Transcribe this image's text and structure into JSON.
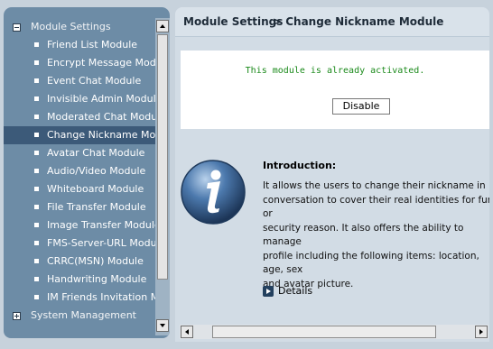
{
  "sidebar": {
    "groups": [
      {
        "label": "Module Settings",
        "expanded": true,
        "items": [
          {
            "label": "Friend List Module"
          },
          {
            "label": "Encrypt Message Module"
          },
          {
            "label": "Event Chat Module"
          },
          {
            "label": "Invisible Admin Module"
          },
          {
            "label": "Moderated Chat Module"
          },
          {
            "label": "Change Nickname Module"
          },
          {
            "label": "Avatar Chat Module"
          },
          {
            "label": "Audio/Video Module"
          },
          {
            "label": "Whiteboard Module"
          },
          {
            "label": "File Transfer Module"
          },
          {
            "label": "Image Transfer Module"
          },
          {
            "label": "FMS-Server-URL Module"
          },
          {
            "label": "CRRC(MSN) Module"
          },
          {
            "label": "Handwriting Module"
          },
          {
            "label": "IM Friends Invitation Module"
          }
        ]
      },
      {
        "label": "System Management",
        "expanded": false
      }
    ],
    "selected_item": "Change Nickname Module"
  },
  "header": {
    "section": "Module Settings",
    "breadcrumb": "> Change Nickname Module"
  },
  "status": {
    "message": "This module is already activated.",
    "button_label": "Disable"
  },
  "intro": {
    "title": "Introduction:",
    "lines": [
      "It allows the users to change their nickname in",
      "conversation to cover their real identities for fun or",
      "security reason. It also offers the ability to manage",
      "profile including the following items: location, age, sex",
      "and avatar picture."
    ]
  },
  "details_label": "Details",
  "colors": {
    "sidebar_bg": "#6d8ca6",
    "selected_bg": "#3c5a79",
    "content_bg": "#d2dce5",
    "status_text": "#1b8a1b"
  }
}
